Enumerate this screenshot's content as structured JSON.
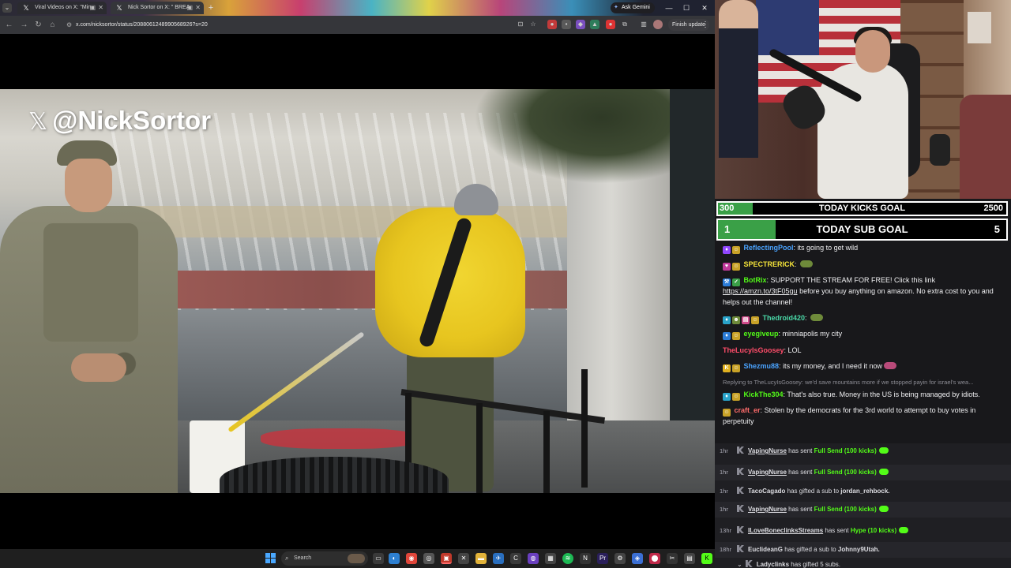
{
  "browser": {
    "tabs": [
      {
        "title": "Viral Videos",
        "title2": "on X: \"Min"
      },
      {
        "title": "Nick Sortor on X: \"",
        "title2": "BREA"
      }
    ],
    "ask_gemini": "Ask Gemini",
    "url": "x.com/nicksortor/status/2088061248990568926?s=20",
    "finish_update": "Finish update"
  },
  "video": {
    "watermark_handle": "@NickSortor",
    "watermark_logo": "𝕏"
  },
  "taskbar": {
    "search_placeholder": "Search"
  },
  "goals": {
    "kicks": {
      "current": "300",
      "title": "TODAY KICKS GOAL",
      "target": "2500",
      "progress": 0.12
    },
    "subs": {
      "current": "1",
      "title": "TODAY SUB GOAL",
      "target": "5",
      "progress": 0.2
    }
  },
  "chat": {
    "messages": [
      {
        "user": "ReflectingPool",
        "color": "#4aa3ff",
        "text": "its going to get wild"
      },
      {
        "user": "SPECTRERICK",
        "color": "#f5e43a",
        "text": ""
      },
      {
        "user": "BotRix",
        "color": "#53fc18",
        "text": "SUPPORT THE STREAM FOR FREE! Click this link",
        "link": "https://amzn.to/3tF05gu",
        "text2": "before you buy anything on amazon. No extra cost to you and helps out the channel!"
      },
      {
        "user": "Thedroid420",
        "color": "#4ad9a8",
        "text": ""
      },
      {
        "user": "eyegiveup",
        "color": "#53fc18",
        "text": "minniapolis my city"
      },
      {
        "user": "TheLucyIsGoosey",
        "color": "#ff4d6a",
        "text": "LOL"
      },
      {
        "user": "Shezmu88",
        "color": "#4aa3ff",
        "text": "its my money, and I need it now"
      },
      {
        "reply": "Replying to TheLucyIsGoosey: we'd save mountains more if we stopped payin for israel's wea..."
      },
      {
        "user": "KickThe304",
        "color": "#53fc18",
        "text": "That's also true. Money in the US is being managed by idiots."
      },
      {
        "user": "craft_er",
        "color": "#ff6b6b",
        "text": "Stolen by the democrats for the 3rd world to attempt to buy votes in perpetuity"
      }
    ]
  },
  "events": [
    {
      "time": "1hr",
      "user": "VapingNurse",
      "action": "has sent",
      "item": "Full Send (100 kicks)"
    },
    {
      "time": "1hr",
      "user": "VapingNurse",
      "action": "has sent",
      "item": "Full Send (100 kicks)"
    },
    {
      "time": "1hr",
      "user": "TacoCagado",
      "action": "has gifted a sub to",
      "target": "jordan_rehbock."
    },
    {
      "time": "1hr",
      "user": "VapingNurse",
      "action": "has sent",
      "item": "Full Send (100 kicks)"
    },
    {
      "time": "13hr",
      "user": "ILoveBoneclinksStreams",
      "action": "has sent",
      "item": "Hype (10 kicks)"
    },
    {
      "time": "18hr",
      "user": "EuclideanG",
      "action": "has gifted a sub to",
      "target": "Johnny9Utah."
    },
    {
      "time": "",
      "user": "Ladyclinks",
      "action": "has gifted 5 subs."
    }
  ],
  "colors": {
    "accent_green": "#53fc18",
    "goal_fill": "#3aa047",
    "chat_bg": "#18181b"
  }
}
